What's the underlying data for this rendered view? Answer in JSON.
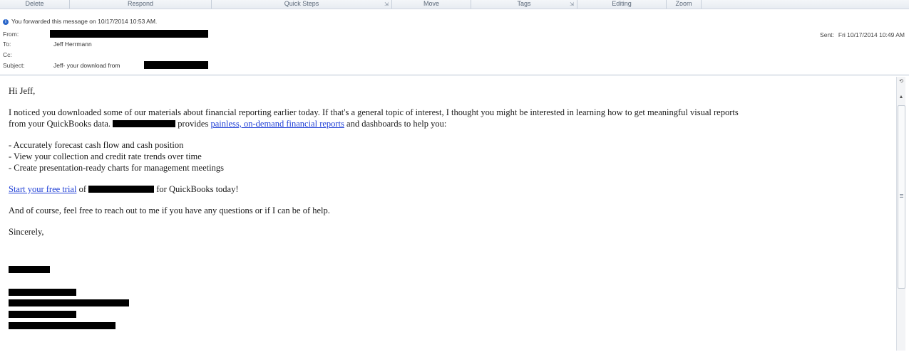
{
  "ribbon": {
    "groups": [
      "Delete",
      "Respond",
      "Quick Steps",
      "Move",
      "Tags",
      "Editing",
      "Zoom"
    ]
  },
  "header": {
    "forward_info": "You forwarded this message on 10/17/2014 10:53 AM.",
    "from_label": "From:",
    "to_label": "To:",
    "to_value": "Jeff Herrmann",
    "cc_label": "Cc:",
    "subject_label": "Subject:",
    "subject_value": "Jeff- your download from",
    "sent_label": "Sent:",
    "sent_value": "Fri 10/17/2014 10:49 AM"
  },
  "body": {
    "greeting": "Hi Jeff,",
    "para1_part1": "I noticed you downloaded some of our materials about financial reporting earlier today. If that's a general topic of interest, I thought you might be interested in learning how to get meaningful visual reports",
    "para1_part2": "from your QuickBooks data.",
    "para1_provides": "provides",
    "para1_link": "painless, on-demand financial reports",
    "para1_end": "and dashboards to help you:",
    "bullets": [
      "- Accurately forecast cash flow and cash position",
      "- View your collection and credit rate trends over time",
      "- Create presentation-ready charts for management meetings"
    ],
    "trial_link": "Start your free trial",
    "trial_of": "of",
    "trial_end": "for QuickBooks today!",
    "para_reach": "And of course, feel free to reach out to me if you have any questions or if I can be of help.",
    "closing": "Sincerely,"
  }
}
